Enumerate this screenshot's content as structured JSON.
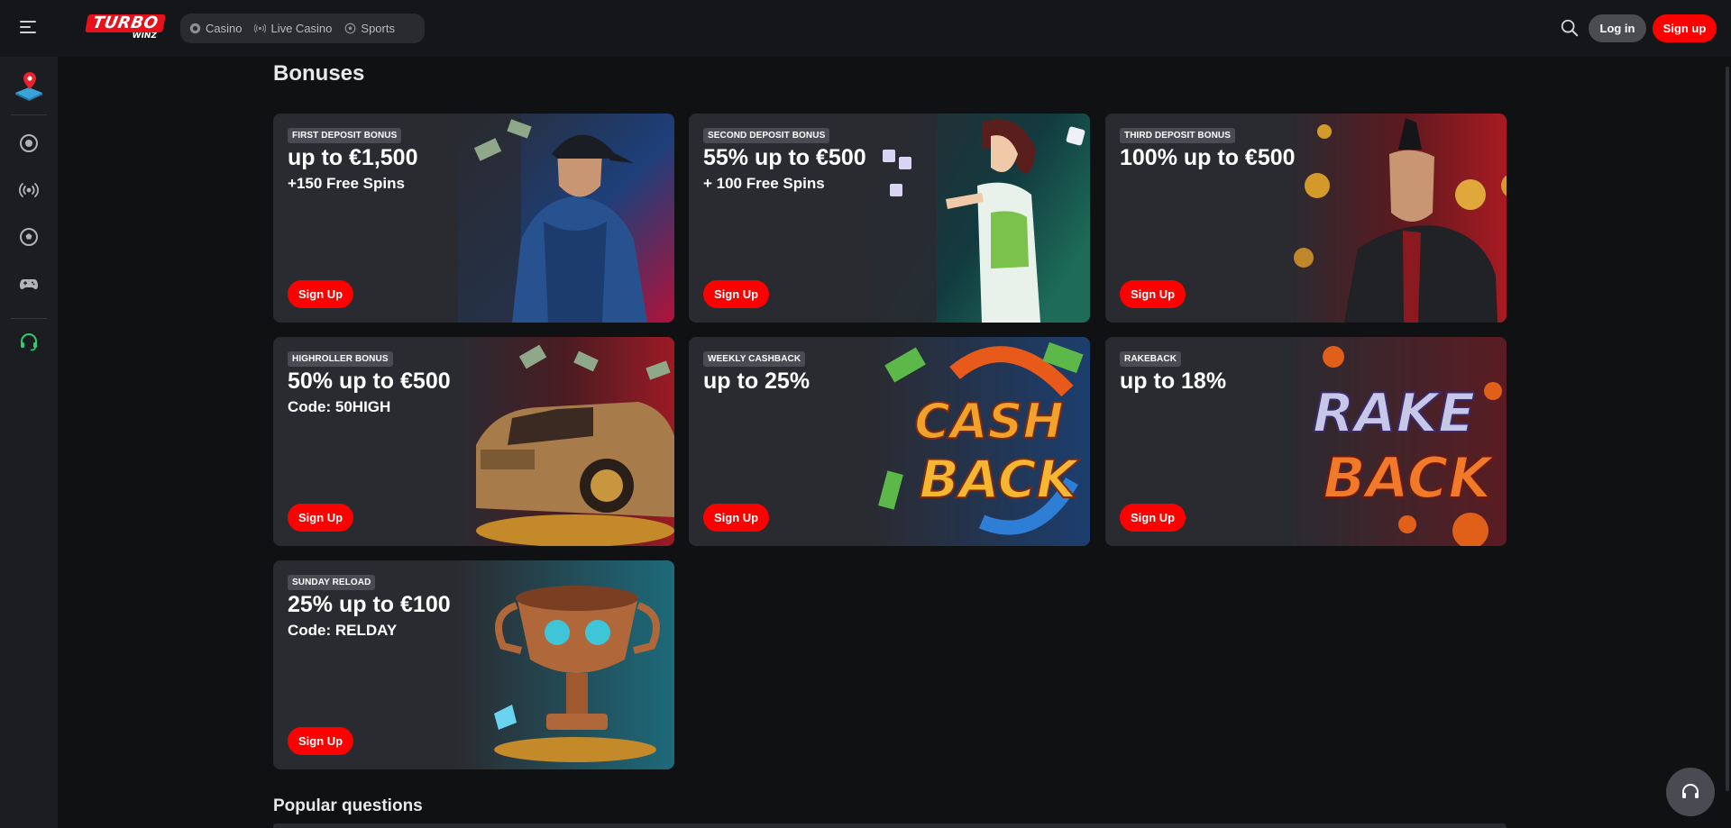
{
  "header": {
    "logo_top": "TURBO",
    "logo_bottom": "WINZ",
    "nav": [
      {
        "label": "Casino",
        "icon": "casino-chip-icon"
      },
      {
        "label": "Live Casino",
        "icon": "live-broadcast-icon"
      },
      {
        "label": "Sports",
        "icon": "soccer-ball-icon"
      }
    ],
    "login_label": "Log in",
    "signup_label": "Sign up"
  },
  "sidebar": {
    "items": [
      "map-pin-icon",
      "casino-chip-icon",
      "live-broadcast-icon",
      "soccer-ball-icon",
      "gamepad-icon",
      "support-headset-icon"
    ]
  },
  "main": {
    "title": "Bonuses",
    "cards": [
      {
        "tag": "FIRST DEPOSIT BONUS",
        "headline": "up to €1,500",
        "subline": "+150 Free Spins",
        "cta": "Sign Up",
        "art": "hooded-man"
      },
      {
        "tag": "SECOND DEPOSIT BONUS",
        "headline": "55% up to €500",
        "subline": "+ 100 Free Spins",
        "cta": "Sign Up",
        "art": "dice-woman"
      },
      {
        "tag": "THIRD DEPOSIT BONUS",
        "headline": "100% up to €500",
        "subline": "",
        "cta": "Sign Up",
        "art": "mohawk-man"
      },
      {
        "tag": "HIGHROLLER BONUS",
        "headline": "50% up to €500",
        "subline": "Code: 50HIGH",
        "cta": "Sign Up",
        "art": "gold-car"
      },
      {
        "tag": "WEEKLY CASHBACK",
        "headline": "up to 25%",
        "subline": "",
        "cta": "Sign Up",
        "art": "cashback-logo"
      },
      {
        "tag": "RAKEBACK",
        "headline": "up to 18%",
        "subline": "",
        "cta": "Sign Up",
        "art": "rakeback-logo"
      },
      {
        "tag": "SUNDAY RELOAD",
        "headline": "25% up to €100",
        "subline": "Code: RELDAY",
        "cta": "Sign Up",
        "art": "trophy-cup"
      }
    ],
    "art_text": {
      "cash": "CASH",
      "back": "BACK",
      "rake": "RAKE"
    },
    "faq_title": "Popular questions"
  },
  "colors": {
    "accent": "#ff0000",
    "card_bg": "#2a2b31",
    "page_bg": "#101113",
    "tag_bg": "#4a4b53",
    "support_green": "#2ecc71"
  }
}
